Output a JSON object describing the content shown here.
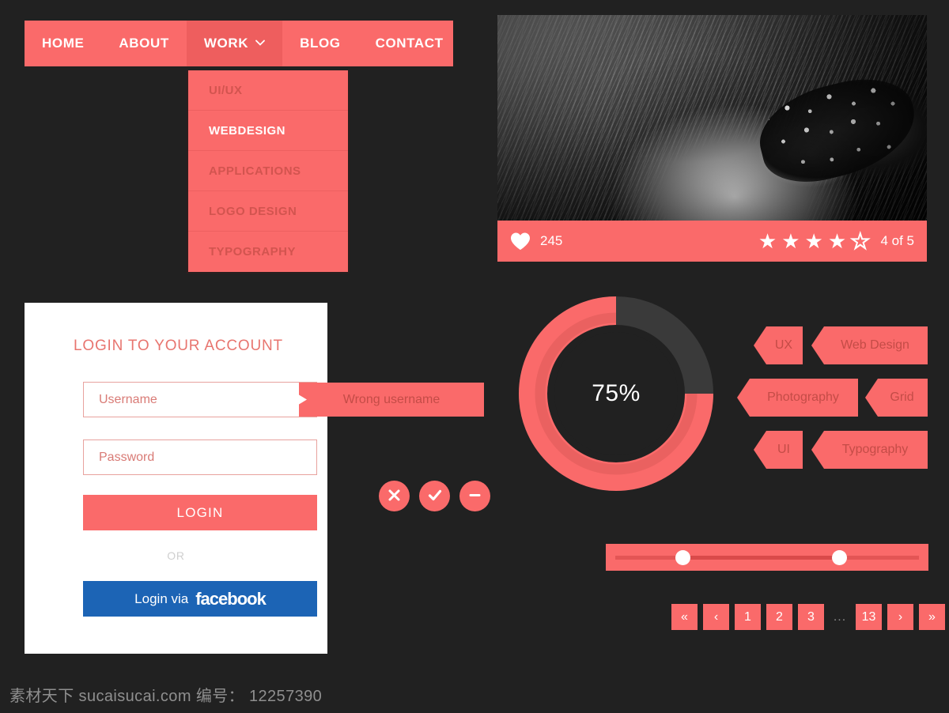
{
  "theme": {
    "accent": "#FA6A6A",
    "accent_dark": "#EE5E5E",
    "background": "#212121",
    "panel": "#FFFFFF",
    "facebook_blue": "#1C64B5",
    "text_on_accent": "#C44C47",
    "track_dark": "#3A3A3A"
  },
  "nav": {
    "items": [
      {
        "label": "HOME",
        "active": false
      },
      {
        "label": "ABOUT",
        "active": false
      },
      {
        "label": "WORK",
        "active": true,
        "caret": "chevron-down-icon"
      },
      {
        "label": "BLOG",
        "active": false
      },
      {
        "label": "CONTACT",
        "active": false
      }
    ]
  },
  "dropdown": {
    "items": [
      {
        "label": "UI/UX",
        "active": false
      },
      {
        "label": "WEBDESIGN",
        "active": true
      },
      {
        "label": "APPLICATIONS",
        "active": false
      },
      {
        "label": "LOGO DESIGN",
        "active": false
      },
      {
        "label": "TYPOGRAPHY",
        "active": false
      }
    ]
  },
  "photo_card": {
    "image_alt": "black-and-white close-up of a woman's eye with feather makeup",
    "likes_icon": "heart-icon",
    "likes_count": "245",
    "rating_filled": 4,
    "rating_total": 5,
    "rating_text": "4 of 5",
    "star_filled_glyph": "★",
    "star_empty_glyph": "★"
  },
  "login": {
    "title": "LOGIN TO YOUR ACCOUNT",
    "username_placeholder": "Username",
    "username_value": "",
    "password_placeholder": "Password",
    "password_value": "",
    "login_label": "LOGIN",
    "or_label": "OR",
    "facebook_prefix": "Login via",
    "facebook_brand": "facebook",
    "tooltip_text": "Wrong username"
  },
  "circle_buttons": [
    {
      "name": "close-button",
      "icon": "close-icon"
    },
    {
      "name": "confirm-button",
      "icon": "check-icon"
    },
    {
      "name": "remove-button",
      "icon": "minus-icon"
    }
  ],
  "chart_data": {
    "type": "pie",
    "variant": "donut-progress",
    "title": "",
    "label": "75%",
    "value": 75,
    "max": 100,
    "unit": "%",
    "start_angle_deg": 0,
    "direction": "counterclockwise",
    "slices": [
      {
        "name": "complete",
        "value": 75,
        "color": "#FA6A6A"
      },
      {
        "name": "remaining",
        "value": 25,
        "color": "#3A3A3A"
      }
    ],
    "inner_ring_color": "#E8605F",
    "outer_ring_color": "#FA6A6A",
    "legend": "none",
    "grid": false
  },
  "tags": [
    {
      "label": "UX"
    },
    {
      "label": "Web Design"
    },
    {
      "label": "Photography"
    },
    {
      "label": "Grid"
    },
    {
      "label": "UI"
    },
    {
      "label": "Typography"
    }
  ],
  "slider": {
    "low_value": 20,
    "high_value": 70,
    "min": 0,
    "max": 100
  },
  "pagination": {
    "items": [
      {
        "label": "«",
        "name": "pagination-first"
      },
      {
        "label": "‹",
        "name": "pagination-prev"
      },
      {
        "label": "1",
        "name": "pagination-page-1"
      },
      {
        "label": "2",
        "name": "pagination-page-2"
      },
      {
        "label": "3",
        "name": "pagination-page-3"
      }
    ],
    "ellipsis": "...",
    "tail": [
      {
        "label": "13",
        "name": "pagination-page-13"
      },
      {
        "label": "›",
        "name": "pagination-next"
      },
      {
        "label": "»",
        "name": "pagination-last"
      }
    ]
  },
  "watermark": "素材天下 sucaisucai.com  编号： 12257390"
}
